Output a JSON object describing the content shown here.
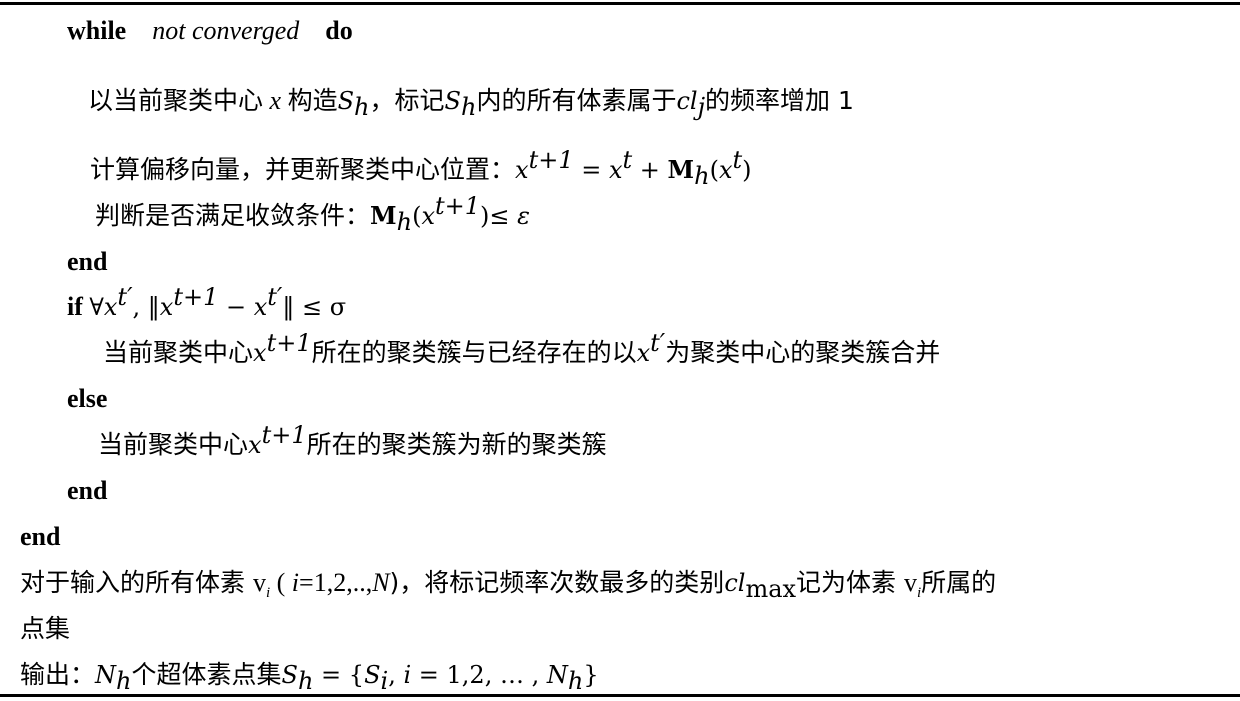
{
  "algorithm": {
    "lines": [
      {
        "id": "while",
        "keyword_while": "while",
        "condition": "not converged",
        "keyword_do": "do"
      },
      {
        "id": "construct",
        "t1": "以当前聚类中心",
        "var_x": "x",
        "t2": "构造",
        "S": "S",
        "S_sub": "h",
        "t3": "，标记",
        "t4": "内的所有体素属于",
        "cl": "cl",
        "cl_sub": "j",
        "t5": "的频率增加 1"
      },
      {
        "id": "update",
        "t1": "计算偏移向量，并更新聚类中心位置：",
        "formula": {
          "x": "x",
          "sup_next": "t+1",
          "eq": " = ",
          "sup_t": "t",
          "plus": " + ",
          "M": "M",
          "M_sub": "h",
          "open": "(",
          "close": ")"
        }
      },
      {
        "id": "check",
        "t1": "判断是否满足收敛条件：",
        "M": "M",
        "M_sub": "h",
        "open": "(",
        "x": "x",
        "sup": "t+1",
        "close": ")",
        "le": "≤ ",
        "eps": "ε"
      },
      {
        "id": "end-while",
        "keyword": "end"
      },
      {
        "id": "if",
        "keyword": "if",
        "forall": "∀",
        "x": "x",
        "sup_prime": "t′",
        "comma": ", ",
        "norm_open": "‖",
        "sup_next": "t+1",
        "minus": " − ",
        "norm_close": "‖",
        "le": " ≤ ",
        "sigma": "σ"
      },
      {
        "id": "merge",
        "t1": "当前聚类中心",
        "x": "x",
        "sup": "t+1",
        "t2": "所在的聚类簇与已经存在的以",
        "sup_prime": "t′",
        "t3": "为聚类中心的聚类簇合并"
      },
      {
        "id": "else",
        "keyword": "else"
      },
      {
        "id": "new-cluster",
        "t1": "当前聚类中心",
        "x": "x",
        "sup": "t+1",
        "t2": "所在的聚类簇为新的聚类簇"
      },
      {
        "id": "end-if",
        "keyword": "end"
      },
      {
        "id": "end-outer",
        "keyword": "end"
      },
      {
        "id": "assign",
        "t1": "对于输入的所有体素 ",
        "v": "v",
        "v_sub": "i",
        "t2": " ( ",
        "i": "i",
        "range": "=1,2,..,",
        "N": "N",
        "t3": ")，将标记频率次数最多的类别",
        "cl": "cl",
        "cl_sub": "max",
        "t4": "记为体素 ",
        "t5": "所属的"
      },
      {
        "id": "assign-cont",
        "t1": "点集"
      },
      {
        "id": "output",
        "t1": "输出：",
        "N": "N",
        "N_sub": "h",
        "t2": "个超体素点集",
        "S": "S",
        "S_sub": "h",
        "eq": " = {",
        "Si": "S",
        "Si_sub": "i",
        "comma": ", ",
        "i": "i",
        "range": " = 1,2, … , ",
        "close": "}"
      }
    ]
  }
}
